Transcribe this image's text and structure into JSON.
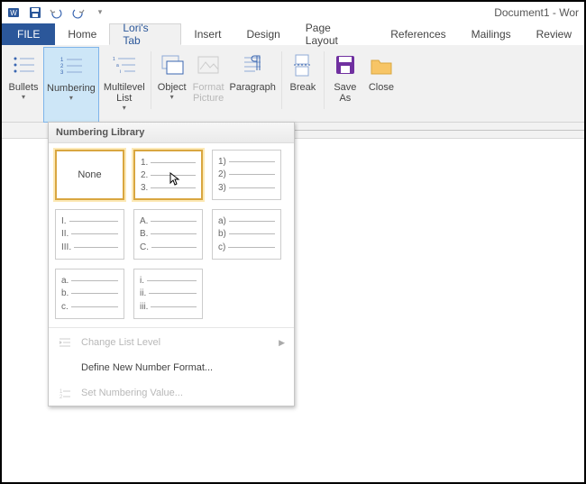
{
  "app": {
    "title": "Document1 - Wor"
  },
  "tabs": {
    "file": "FILE",
    "items": [
      "Home",
      "Lori's Tab",
      "Insert",
      "Design",
      "Page Layout",
      "References",
      "Mailings",
      "Review"
    ],
    "active_index": 1
  },
  "ribbon": {
    "bullets": "Bullets",
    "numbering": "Numbering",
    "multilevel": "Multilevel\nList",
    "object": "Object",
    "format_picture": "Format\nPicture",
    "paragraph": "Paragraph",
    "pagebreak": "Break",
    "saveas": "Save\nAs",
    "close": "Close"
  },
  "dropdown": {
    "header": "Numbering Library",
    "none": "None",
    "tiles": [
      [
        "1.",
        "2.",
        "3."
      ],
      [
        "1)",
        "2)",
        "3)"
      ],
      [
        "I.",
        "II.",
        "III."
      ],
      [
        "A.",
        "B.",
        "C."
      ],
      [
        "a)",
        "b)",
        "c)"
      ],
      [
        "a.",
        "b.",
        "c."
      ],
      [
        "i.",
        "ii.",
        "iii."
      ]
    ],
    "menu": {
      "change_level": "Change List Level",
      "define_new": "Define New Number Format...",
      "set_value": "Set Numbering Value..."
    }
  }
}
